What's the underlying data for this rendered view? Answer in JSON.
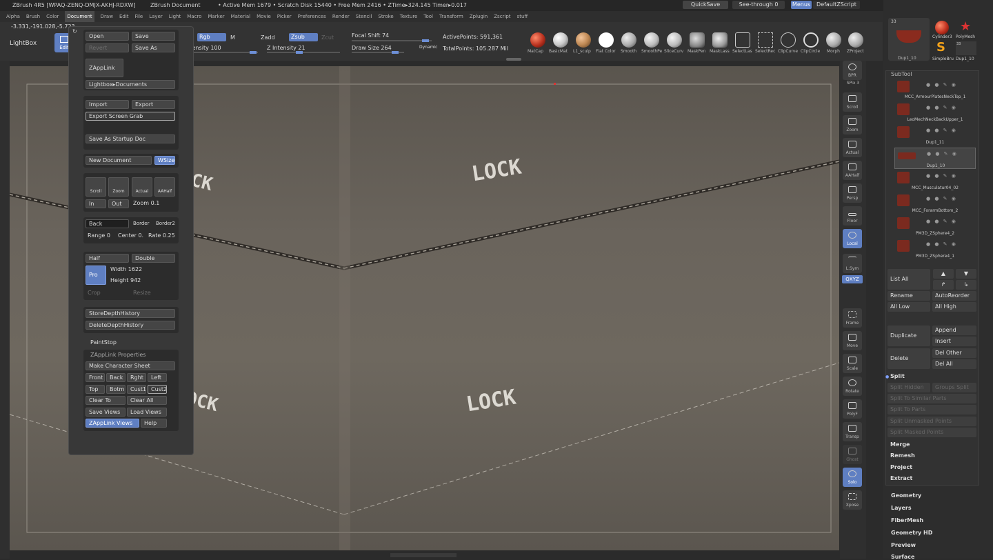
{
  "title_bar": {
    "app": "ZBrush 4R5 [WPAQ-ZENQ-DMJX-AKHJ-RDXW]",
    "doc": "ZBrush Document",
    "stats": "• Active Mem 1679  • Scratch Disk 15440  • Free Mem 2416  • ZTime▸324.145 Timer▸0.017",
    "quicksave": "QuickSave",
    "seethrough": "See-through  0",
    "menus": "Menus",
    "script": "DefaultZScript"
  },
  "menu": [
    "Alpha",
    "Brush",
    "Color",
    "Document",
    "Draw",
    "Edit",
    "File",
    "Layer",
    "Light",
    "Macro",
    "Marker",
    "Material",
    "Movie",
    "Picker",
    "Preferences",
    "Render",
    "Stencil",
    "Stroke",
    "Texture",
    "Tool",
    "Transform",
    "Zplugin",
    "Zscript",
    "stuff"
  ],
  "toolbar": {
    "coords": "-3.331,-191.028,-5.723",
    "lightbox": "LightBox",
    "edit": "Edit",
    "rgb": "Rgb",
    "m": "M",
    "zadd": "Zadd",
    "zsub": "Zsub",
    "zcut": "Zcut",
    "rgb_intensity": "Intensity 100",
    "z_intensity": "Z Intensity 21",
    "focal_shift": "Focal Shift 74",
    "draw_size": "Draw Size 264",
    "dynamic": "Dynamic",
    "active_points": "ActivePoints: 591,361",
    "total_points": "TotalPoints: 105.287 Mil"
  },
  "materials": [
    {
      "label": "MatCap",
      "color": "#b8301e"
    },
    {
      "label": "BasicMat",
      "color": "#c9c9c9"
    },
    {
      "label": "L1_sculp",
      "color": "#c08a55"
    },
    {
      "label": "Flat Color",
      "color": "#ffffff"
    },
    {
      "label": "Smooth",
      "color": "#bdbdbd"
    },
    {
      "label": "SmoothPe",
      "color": "#d0d0d0"
    },
    {
      "label": "SliceCurv",
      "color": "#d8d8d8"
    },
    {
      "label": "MaskPen",
      "color": "#a8a8a8"
    },
    {
      "label": "MaskLass",
      "color": "#cfcfcf"
    },
    {
      "label": "SelectLas",
      "color": "#555555"
    },
    {
      "label": "SelectRec",
      "color": "#555555"
    },
    {
      "label": "ClipCurve",
      "color": "#555555"
    },
    {
      "label": "ClipCircle",
      "color": "#555555"
    },
    {
      "label": "Morph",
      "color": "#c6c6c6"
    },
    {
      "label": "ZProject",
      "color": "#c6c6c6"
    }
  ],
  "doc_menu": {
    "open": "Open",
    "save": "Save",
    "revert": "Revert",
    "save_as": "Save As",
    "zapplink": "ZAppLink",
    "lightbox_docs": "Lightbox▸Documents",
    "import": "Import",
    "export": "Export",
    "export_screen_grab": "Export Screen Grab",
    "save_startup": "Save As Startup Doc",
    "new_document": "New Document",
    "wsize": "WSize",
    "scroll": "Scroll",
    "zoom": "Zoom",
    "actual": "Actual",
    "aahalf": "AAHalf",
    "in": "In",
    "out": "Out",
    "zoom_value": "Zoom 0.1",
    "back": "Back",
    "border": "Border",
    "border2": "Border2",
    "range": "Range 0",
    "center": "Center 0.",
    "rate": "Rate 0.25",
    "half": "Half",
    "double": "Double",
    "pro": "Pro",
    "width": "Width 1622",
    "height": "Height 942",
    "crop": "Crop",
    "resize": "Resize",
    "store_depth": "StoreDepthHistory",
    "delete_depth": "DeleteDepthHistory",
    "paintstop": "PaintStop",
    "zapplink_props": "ZAppLink Properties",
    "make_char_sheet": "Make Character Sheet",
    "front": "Front",
    "back_v": "Back",
    "rght": "Rght",
    "left": "Left",
    "top": "Top",
    "botm": "Botm",
    "cust1": "Cust1",
    "cust2": "Cust2",
    "clear_to": "Clear To",
    "clear_all": "Clear All",
    "save_views": "Save Views",
    "load_views": "Load Views",
    "zapplink_views": "ZAppLink Views",
    "help": "Help"
  },
  "canvas": {
    "lock_text": "LOCK"
  },
  "shelf": [
    {
      "label": "BPR"
    },
    {
      "label": "SPix 3"
    },
    {
      "label": "Scroll"
    },
    {
      "label": "Zoom"
    },
    {
      "label": "Actual"
    },
    {
      "label": "AAHalf"
    },
    {
      "label": "Persp"
    },
    {
      "label": "Floor"
    },
    {
      "label": "Local"
    },
    {
      "label": "L.Sym"
    },
    {
      "label": "QXYZ"
    },
    {
      "label": "Frame"
    },
    {
      "label": "Move"
    },
    {
      "label": "Scale"
    },
    {
      "label": "Rotate"
    },
    {
      "label": "PolyF"
    },
    {
      "label": "Transp"
    },
    {
      "label": "Ghost"
    },
    {
      "label": "Solo"
    },
    {
      "label": "Xpose"
    }
  ],
  "right_panel": {
    "top_count": "33",
    "tool_labels": [
      "Cylinder3",
      "PolyMesh",
      "SimpleBru",
      "Dup1_10"
    ],
    "thumb_count2": "33",
    "dup_label": "Dup1_10",
    "subtool_header": "SubTool",
    "subtools": [
      "MCC_ArmourPlatesNeckTop_1",
      "LeoMechNeckBackUpper_1",
      "Dup1_11",
      "Dup1_10",
      "MCC_Musculatur04_02",
      "MCC_ForarmBottom_2",
      "PM3D_ZSphere4_2",
      "PM3D_ZSphere4_1"
    ],
    "list_all": "List All",
    "rename": "Rename",
    "autoreorder": "AutoReorder",
    "all_low": "All Low",
    "all_high": "All High",
    "duplicate": "Duplicate",
    "append": "Append",
    "insert": "Insert",
    "delete": "Delete",
    "del_other": "Del Other",
    "del_all": "Del All",
    "split": "Split",
    "split_hidden": "Split Hidden",
    "groups_split": "Groups Split",
    "split_similar": "Split To Similar Parts",
    "split_parts": "Split To Parts",
    "split_unmasked": "Split Unmasked Points",
    "split_masked": "Split Masked Points",
    "merge": "Merge",
    "remesh": "Remesh",
    "project": "Project",
    "extract": "Extract",
    "categories": [
      "Geometry",
      "Layers",
      "FiberMesh",
      "Geometry HD",
      "Preview",
      "Surface"
    ]
  }
}
